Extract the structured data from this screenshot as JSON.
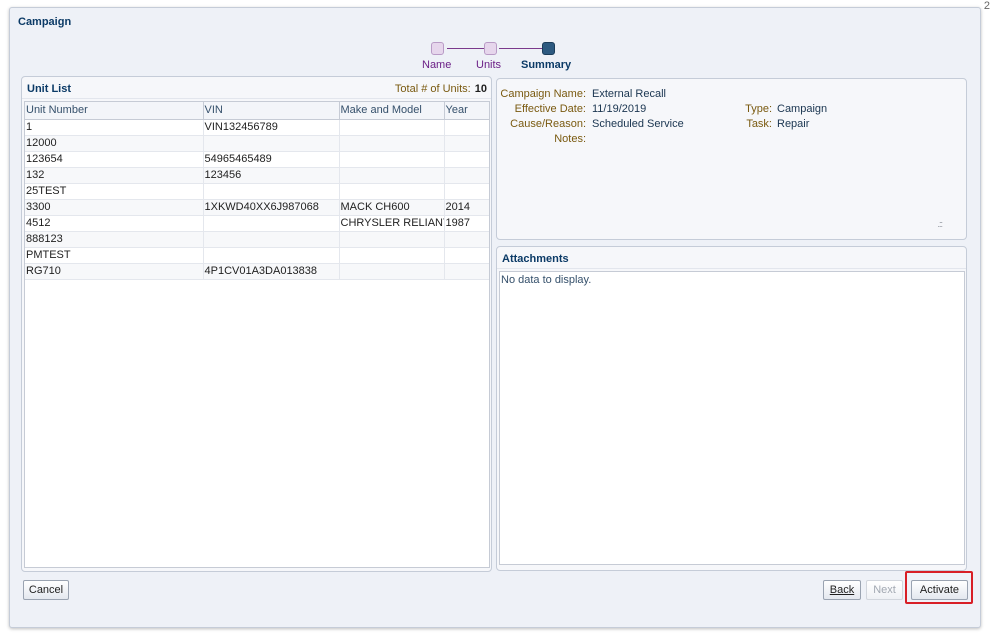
{
  "dialog": {
    "title": "Campaign",
    "corner_number": "2"
  },
  "train": {
    "steps": [
      {
        "label": "Name",
        "state": "visited"
      },
      {
        "label": "Units",
        "state": "visited"
      },
      {
        "label": "Summary",
        "state": "current"
      }
    ]
  },
  "unit_list": {
    "title": "Unit List",
    "total_label": "Total # of Units:",
    "total_value": "10",
    "columns": [
      "Unit Number",
      "VIN",
      "Make and Model",
      "Year"
    ],
    "rows": [
      [
        "1",
        "VIN132456789",
        "",
        ""
      ],
      [
        "12000",
        "",
        "",
        ""
      ],
      [
        "123654",
        "54965465489",
        "",
        ""
      ],
      [
        "132",
        "123456",
        "",
        ""
      ],
      [
        "25TEST",
        "",
        "",
        ""
      ],
      [
        "3300",
        "1XKWD40XX6J987068",
        "MACK CH600",
        "2014"
      ],
      [
        "4512",
        "",
        "CHRYSLER RELIANT",
        "1987"
      ],
      [
        "888123",
        "",
        "",
        ""
      ],
      [
        "PMTEST",
        "",
        "",
        ""
      ],
      [
        "RG710",
        "4P1CV01A3DA013838",
        "",
        ""
      ]
    ]
  },
  "summary": {
    "campaign_name_label": "Campaign Name:",
    "campaign_name": "External Recall",
    "effective_date_label": "Effective Date:",
    "effective_date": "11/19/2019",
    "cause_label": "Cause/Reason:",
    "cause": "Scheduled Service",
    "notes_label": "Notes:",
    "notes": "",
    "type_label": "Type:",
    "type": "Campaign",
    "task_label": "Task:",
    "task": "Repair"
  },
  "attachments": {
    "title": "Attachments",
    "empty_text": "No data to display."
  },
  "buttons": {
    "cancel": "Cancel",
    "back": "Back",
    "next": "Next",
    "activate": "Activate"
  },
  "colors": {
    "title": "#0b3a66",
    "train_visited": "#6b1f86",
    "highlight": "#d81f26",
    "label": "#7a5a10"
  }
}
